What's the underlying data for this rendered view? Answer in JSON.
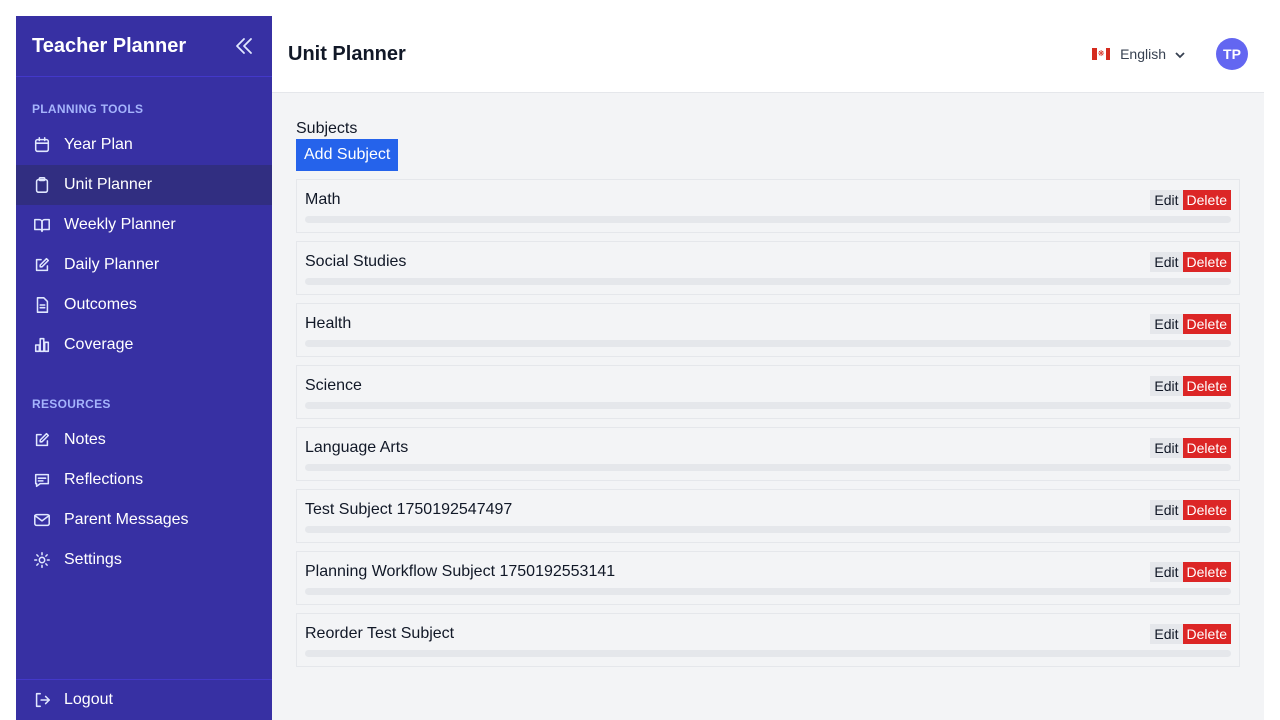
{
  "sidebar": {
    "title": "Teacher Planner",
    "sections": [
      {
        "label": "PLANNING TOOLS",
        "items": [
          {
            "label": "Year Plan",
            "icon": "calendar-icon",
            "active": false
          },
          {
            "label": "Unit Planner",
            "icon": "clipboard-icon",
            "active": true
          },
          {
            "label": "Weekly Planner",
            "icon": "book-open-icon",
            "active": false
          },
          {
            "label": "Daily Planner",
            "icon": "edit-icon",
            "active": false
          },
          {
            "label": "Outcomes",
            "icon": "document-icon",
            "active": false
          },
          {
            "label": "Coverage",
            "icon": "bar-chart-icon",
            "active": false
          }
        ]
      },
      {
        "label": "RESOURCES",
        "items": [
          {
            "label": "Notes",
            "icon": "edit-icon",
            "active": false
          },
          {
            "label": "Reflections",
            "icon": "chat-icon",
            "active": false
          },
          {
            "label": "Parent Messages",
            "icon": "mail-icon",
            "active": false
          },
          {
            "label": "Settings",
            "icon": "gear-icon",
            "active": false
          }
        ]
      }
    ],
    "logout_label": "Logout"
  },
  "header": {
    "page_title": "Unit Planner",
    "language": "English",
    "avatar_initials": "TP"
  },
  "main": {
    "subjects_label": "Subjects",
    "add_subject_label": "Add Subject",
    "edit_label": "Edit",
    "delete_label": "Delete",
    "subjects": [
      "Math",
      "Social Studies",
      "Health",
      "Science",
      "Language Arts",
      "Test Subject 1750192547497",
      "Planning Workflow Subject 1750192553141",
      "Reorder Test Subject"
    ]
  },
  "colors": {
    "sidebar_bg": "#3730a3",
    "sidebar_active": "#312e81",
    "primary_button": "#2563eb",
    "delete_button": "#dc2626",
    "avatar_bg": "#6366f1"
  }
}
